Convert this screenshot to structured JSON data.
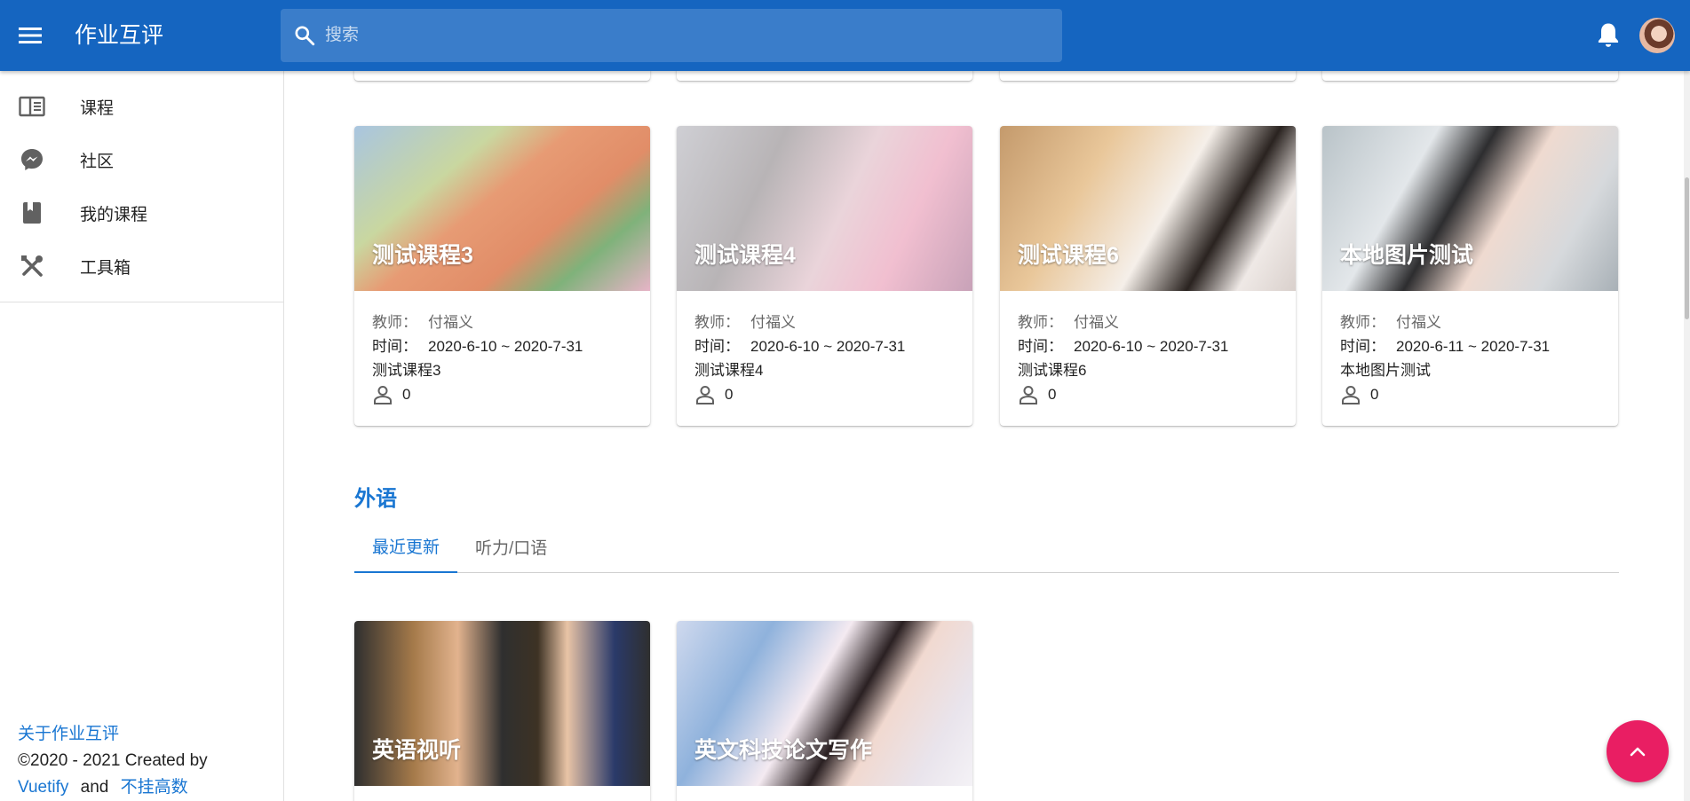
{
  "app": {
    "title": "作业互评"
  },
  "search": {
    "placeholder": "搜索"
  },
  "colors": {
    "primary": "#1565c0",
    "accent": "#1976d2",
    "fab": "#e91e63"
  },
  "sidebar": {
    "items": [
      {
        "label": "课程",
        "icon": "book-open-icon"
      },
      {
        "label": "社区",
        "icon": "messenger-icon"
      },
      {
        "label": "我的课程",
        "icon": "book-icon"
      },
      {
        "label": "工具箱",
        "icon": "tools-icon"
      }
    ],
    "footer": {
      "about": "关于作业互评",
      "copyright": "©2020 - 2021 Created by",
      "vuetify": "Vuetify",
      "and": "and",
      "author": "不挂高数"
    }
  },
  "labels": {
    "teacher": "教师：",
    "time": "时间："
  },
  "courses": [
    {
      "title": "测试课程3",
      "teacher": "付福义",
      "time": "2020-6-10 ~ 2020-7-31",
      "desc": "测试课程3",
      "count": "0"
    },
    {
      "title": "测试课程4",
      "teacher": "付福义",
      "time": "2020-6-10 ~ 2020-7-31",
      "desc": "测试课程4",
      "count": "0"
    },
    {
      "title": "测试课程6",
      "teacher": "付福义",
      "time": "2020-6-10 ~ 2020-7-31",
      "desc": "测试课程6",
      "count": "0"
    },
    {
      "title": "本地图片测试",
      "teacher": "付福义",
      "time": "2020-6-11 ~ 2020-7-31",
      "desc": "本地图片测试",
      "count": "0"
    }
  ],
  "section": {
    "title": "外语",
    "tabs": [
      "最近更新",
      "听力/口语"
    ],
    "active_tab": "最近更新"
  },
  "foreign_courses": [
    {
      "title": "英语视听"
    },
    {
      "title": "英文科技论文写作"
    }
  ]
}
